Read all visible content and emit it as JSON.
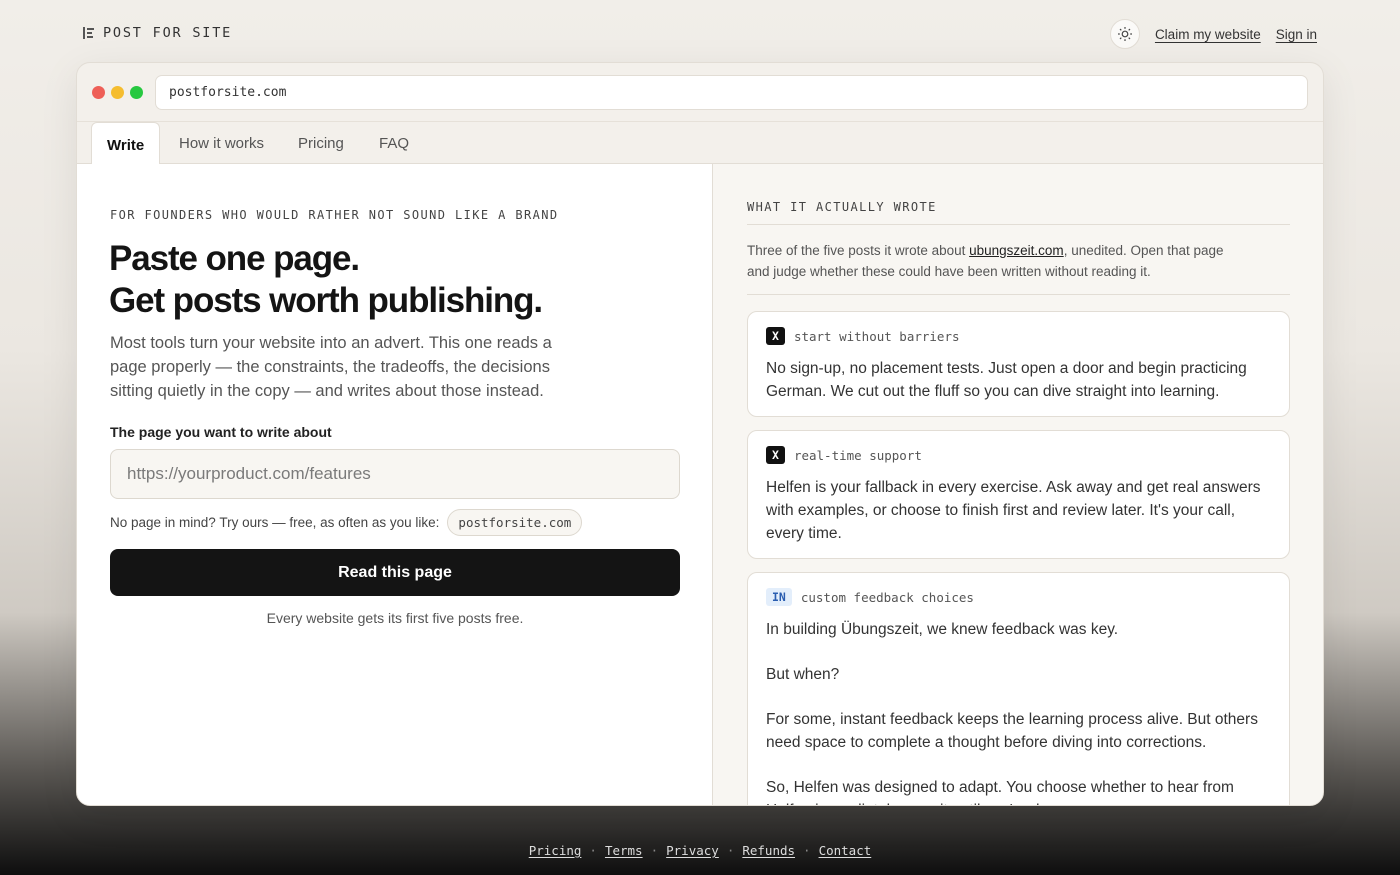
{
  "brand": {
    "name": "POST FOR SITE",
    "icon": "list-logo-icon"
  },
  "header": {
    "theme_icon": "sun-icon",
    "claim_link": "Claim my website",
    "signin_link": "Sign in"
  },
  "window": {
    "dot_colors": [
      "#ee5f57",
      "#f5bd2f",
      "#27c840"
    ],
    "url": "postforsite.com",
    "tabs": [
      {
        "label": "Write",
        "active": true
      },
      {
        "label": "How it works",
        "active": false
      },
      {
        "label": "Pricing",
        "active": false
      },
      {
        "label": "FAQ",
        "active": false
      }
    ]
  },
  "hero": {
    "eyebrow": "FOR FOUNDERS WHO WOULD RATHER NOT SOUND LIKE A BRAND",
    "headline_line1": "Paste one page.",
    "headline_line2": "Get posts worth publishing.",
    "lede": "Most tools turn your website into an advert. This one reads a page properly — the constraints, the tradeoffs, the decisions sitting quietly in the copy — and writes about those instead.",
    "field_label": "The page you want to write about",
    "input_value": "",
    "input_placeholder": "https://yourproduct.com/features",
    "hint_text": "No page in mind? Try ours — free, as often as you like:",
    "hint_chip": "postforsite.com",
    "cta_label": "Read this page",
    "foot_note": "Every website gets its first five posts free."
  },
  "examples": {
    "eyebrow": "WHAT IT ACTUALLY WROTE",
    "intro_before": "Three of the five posts it wrote about ",
    "intro_link": "ubungszeit.com",
    "intro_after": ", unedited. Open that page and judge whether these could have been written without reading it.",
    "posts": [
      {
        "platform": "X",
        "title": "start without barriers",
        "body": [
          "No sign-up, no placement tests. Just open a door and begin practicing German. We cut out the fluff so you can dive straight into learning."
        ]
      },
      {
        "platform": "X",
        "title": "real-time support",
        "body": [
          "Helfen is your fallback in every exercise. Ask away and get real answers with examples, or choose to finish first and review later. It's your call, every time."
        ]
      },
      {
        "platform": "IN",
        "title": "custom feedback choices",
        "body": [
          "In building Übungszeit, we knew feedback was key.",
          "But when?",
          "For some, instant feedback keeps the learning process alive. But others need space to complete a thought before diving into corrections.",
          "So, Helfen was designed to adapt. You choose whether to hear from Helfen immediately or wait until you're done."
        ]
      }
    ]
  },
  "footer": {
    "links": [
      "Pricing",
      "Terms",
      "Privacy",
      "Refunds",
      "Contact"
    ]
  }
}
